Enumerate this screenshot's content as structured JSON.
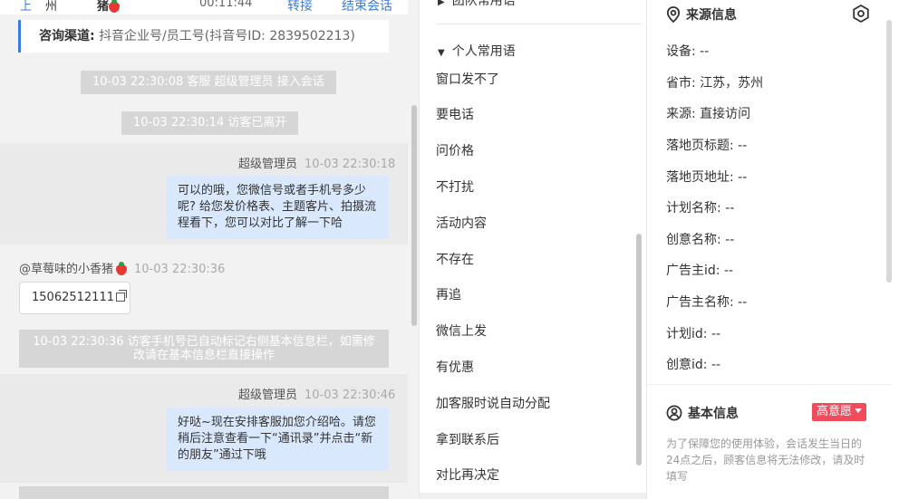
{
  "chat": {
    "header": {
      "left_char": "上",
      "name": "州",
      "name2": "猪",
      "timer": "00:11:44",
      "transfer_label": "转接",
      "end_label": "结束会话"
    },
    "source_card": {
      "label": "咨询渠道:",
      "value": "抖音企业号/员工号(抖音号ID: 2839502213)"
    },
    "system_messages": [
      "10-03 22:30:08 客服 超级管理员 接入会话",
      "10-03 22:30:14 访客已离开",
      "10-03 22:30:36 访客手机号已自动标记右侧基本信息栏，如需修改请在基本信息栏直接操作"
    ],
    "messages": [
      {
        "sender": "超级管理员",
        "time": "10-03 22:30:18",
        "text": "可以的哦，您微信号或者手机号多少呢? 给您发价格表、主题客片、拍摄流程看下，您可以对比了解一下哈"
      },
      {
        "sender": "@草莓味的小香猪",
        "time": "10-03 22:30:36",
        "text": "15062512111"
      },
      {
        "sender": "超级管理员",
        "time": "10-03 22:30:46",
        "text": "好哒~现在安排客服加您介绍哈。请您稍后注意查看一下“通讯录”并点击“新的朋友”通过下哦"
      }
    ]
  },
  "phrases": {
    "team_group_label": "团队常用语",
    "personal_group_label": "个人常用语",
    "items": [
      "窗口发不了",
      "要电话",
      "问价格",
      "不打扰",
      "活动内容",
      "不存在",
      "再追",
      "微信上发",
      "有优惠",
      "加客服时说自动分配",
      "拿到联系后",
      "对比再决定"
    ]
  },
  "info": {
    "source_title": "来源信息",
    "rows": [
      "设备: --",
      "省市: 江苏，苏州",
      "来源: 直接访问",
      "落地页标题: --",
      "落地页地址: --",
      "计划名称: --",
      "创意名称: --",
      "广告主id: --",
      "广告主名称: --",
      "计划id: --",
      "创意id: --"
    ],
    "basic_title": "基本信息",
    "intent_label": "高意愿",
    "notice": "为了保障您的使用体验，会话发生当日的24点之后，顾客信息将无法修改，请及时填写"
  },
  "colors": {
    "accent": "#3b7ddd",
    "bubble": "#d9e8fc",
    "intent": "#f04c5c"
  }
}
